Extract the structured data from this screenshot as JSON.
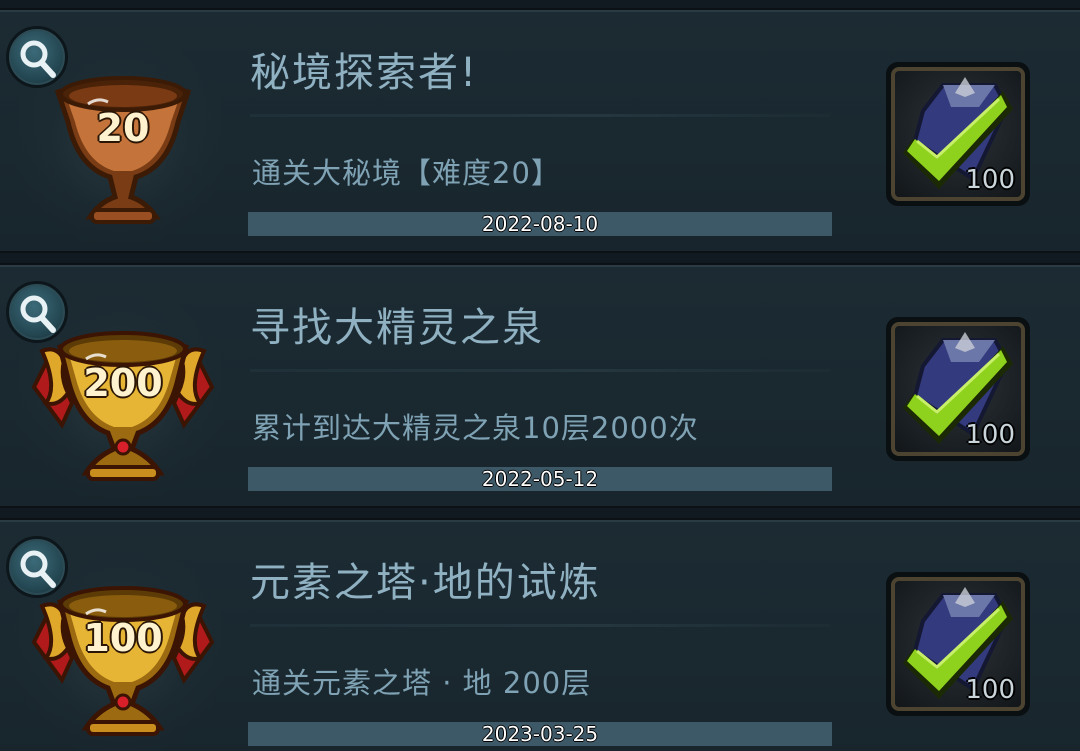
{
  "achievements": [
    {
      "trophy_tier": "bronze",
      "trophy_level": "20",
      "title": "秘境探索者!",
      "description": "通关大秘境【难度20】",
      "date": "2022-08-10",
      "reward_icon": "diamond-check-icon",
      "reward_count": "100"
    },
    {
      "trophy_tier": "gold",
      "trophy_level": "200",
      "title": "寻找大精灵之泉",
      "description": "累计到达大精灵之泉10层2000次",
      "date": "2022-05-12",
      "reward_icon": "diamond-check-icon",
      "reward_count": "100"
    },
    {
      "trophy_tier": "gold",
      "trophy_level": "100",
      "title": "元素之塔·地的试炼",
      "description": "通关元素之塔 · 地 200层",
      "date": "2023-03-25",
      "reward_icon": "diamond-check-icon",
      "reward_count": "100"
    }
  ],
  "colors": {
    "bronze": "#b5652c",
    "gold": "#e0a82a",
    "check": "#8fd21d",
    "gem": "#3a3f86"
  }
}
